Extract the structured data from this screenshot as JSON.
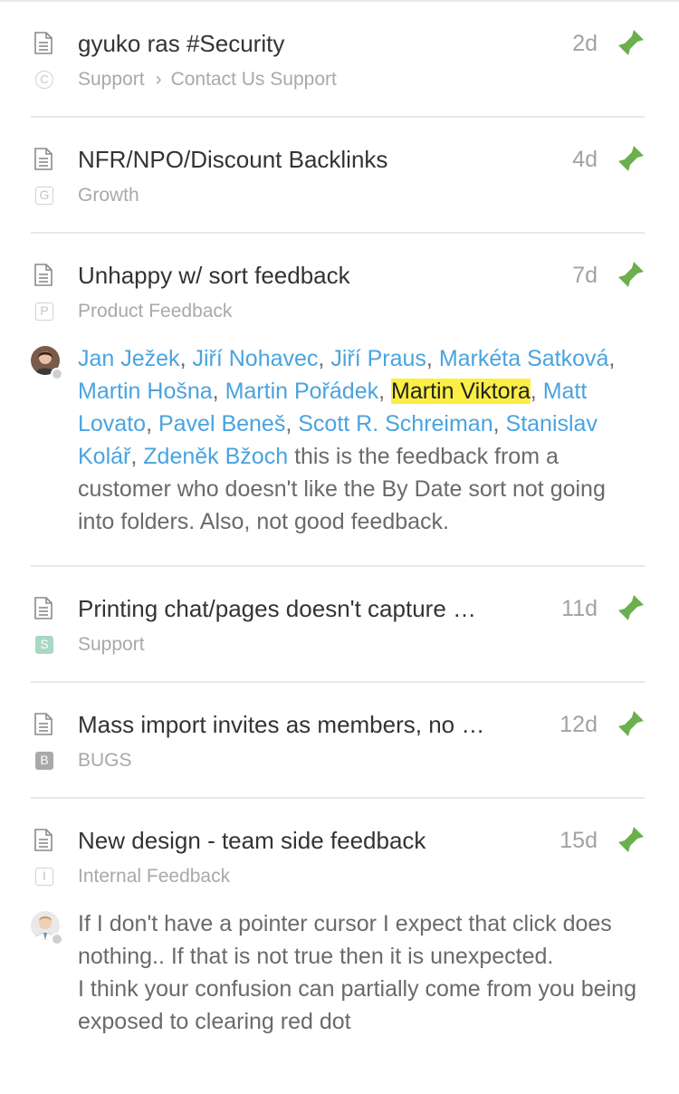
{
  "colors": {
    "pin": "#6ab04c",
    "mention": "#4aa3df",
    "highlight": "#fbef45"
  },
  "items": [
    {
      "title": "gyuko ras #Security",
      "age": "2d",
      "badge": "C",
      "breadcrumb": [
        "Support",
        "Contact Us Support"
      ]
    },
    {
      "title": "NFR/NPO/Discount Backlinks",
      "age": "4d",
      "badge": "G",
      "category": "Growth"
    },
    {
      "title": "Unhappy w/ sort feedback",
      "age": "7d",
      "badge": "P",
      "category": "Product Feedback",
      "comment": {
        "mentions": [
          "Jan Ježek",
          "Jiří Nohavec",
          "Jiří Praus",
          "Markéta Satková",
          "Martin Hošna",
          "Martin Pořádek",
          "Martin Viktora",
          "Matt Lovato",
          "Pavel Beneš",
          "Scott R. Schreiman",
          "Stanislav Kolář",
          "Zdeněk Bžoch"
        ],
        "highlighted_mention": "Martin Viktora",
        "text": "this is the feedback from a customer who doesn't like the By Date sort not going into folders. Also, not good feedback."
      }
    },
    {
      "title": "Printing chat/pages doesn't capture …",
      "age": "11d",
      "badge": "S",
      "category": "Support"
    },
    {
      "title": "Mass import invites as members, no …",
      "age": "12d",
      "badge": "B",
      "category": "BUGS"
    },
    {
      "title": "New design - team side feedback",
      "age": "15d",
      "badge": "I",
      "category": "Internal Feedback",
      "comment": {
        "line1": "If I don't have a pointer cursor I expect that click does nothing.. If that is not true then it is unexpected.",
        "line2": "I think your confusion can partially come from you being exposed to clearing red dot"
      }
    }
  ]
}
